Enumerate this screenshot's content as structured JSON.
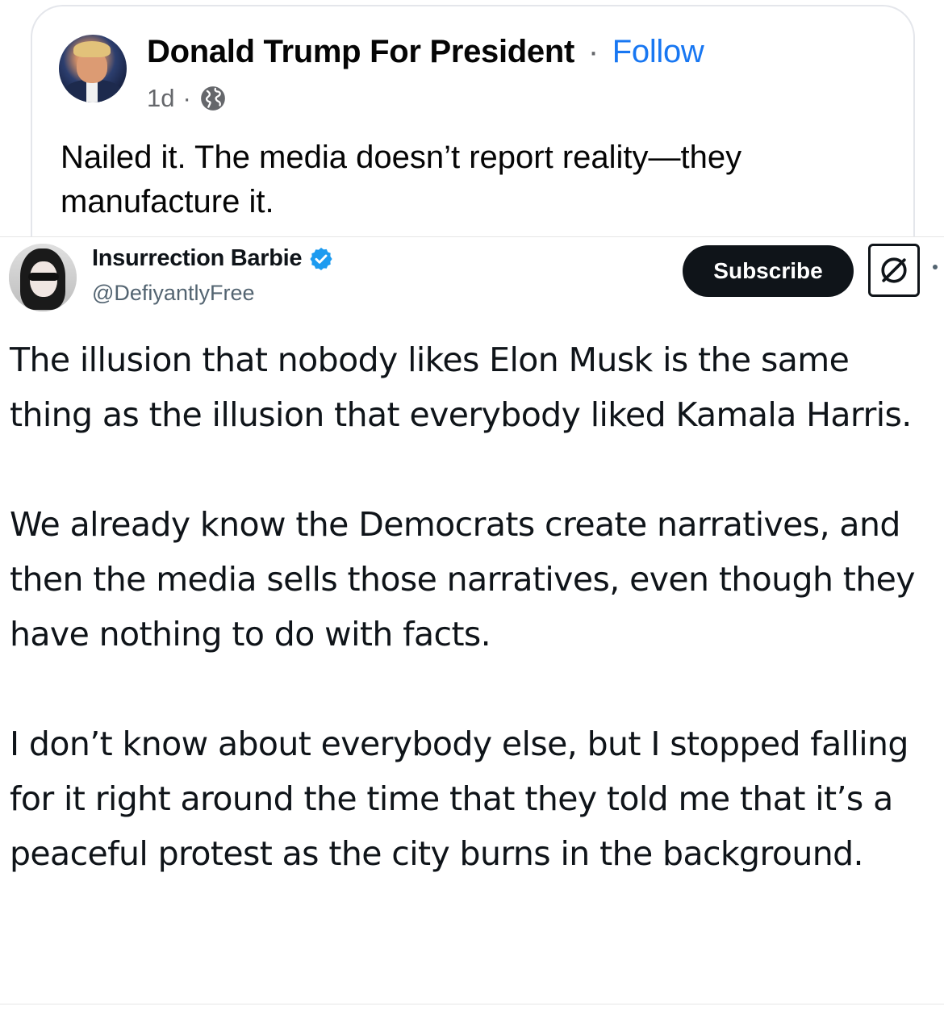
{
  "facebook_post": {
    "author": "Donald Trump For President",
    "separator": "·",
    "follow_label": "Follow",
    "timestamp": "1d",
    "meta_separator": "·",
    "audience_icon": "globe-icon",
    "text": "Nailed it. The media doesn’t report reality—they manufacture it."
  },
  "tweet": {
    "display_name": "Insurrection Barbie",
    "verified_icon": "verified-badge-icon",
    "handle": "@DefiyantlyFree",
    "subscribe_label": "Subscribe",
    "grok_icon": "grok-icon",
    "paragraphs": [
      "The illusion that nobody likes Elon Musk is the same thing as the illusion that everybody liked Kamala Harris.",
      "We already know the Democrats create narratives, and then the media sells those narratives, even though they have nothing to do with facts.",
      "I don’t know about everybody else, but I stopped falling for it right around the time that they told me that it’s a peaceful protest as the city burns in the background."
    ]
  },
  "colors": {
    "facebook_blue": "#1877f2",
    "meta_gray": "#65676b",
    "x_text": "#0f1419",
    "x_secondary": "#536471",
    "verified_blue": "#1d9bf0"
  }
}
